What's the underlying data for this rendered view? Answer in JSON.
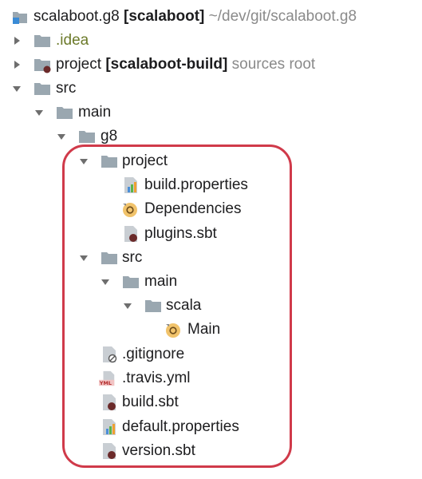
{
  "tree": {
    "root": {
      "name": "scalaboot.g8",
      "module": "[scalaboot]",
      "path": "~/dev/git/scalaboot.g8",
      "icon": "module-folder-icon"
    },
    "idea": {
      "label": ".idea",
      "icon": "folder-icon"
    },
    "project_root": {
      "label": "project",
      "module": "[scalaboot-build]",
      "hint": "sources root",
      "icon": "sbt-folder-icon"
    },
    "src": {
      "label": "src",
      "icon": "folder-icon"
    },
    "main": {
      "label": "main",
      "icon": "folder-icon"
    },
    "g8": {
      "label": "g8",
      "icon": "folder-icon"
    },
    "g8_project": {
      "label": "project",
      "icon": "folder-icon"
    },
    "build_properties": {
      "label": "build.properties",
      "icon": "properties-file-icon"
    },
    "dependencies": {
      "label": "Dependencies",
      "icon": "scala-object-icon"
    },
    "plugins_sbt": {
      "label": "plugins.sbt",
      "icon": "sbt-file-icon"
    },
    "g8_src": {
      "label": "src",
      "icon": "folder-icon"
    },
    "g8_main": {
      "label": "main",
      "icon": "folder-icon"
    },
    "g8_scala": {
      "label": "scala",
      "icon": "folder-icon"
    },
    "main_obj": {
      "label": "Main",
      "icon": "scala-object-icon"
    },
    "gitignore": {
      "label": ".gitignore",
      "icon": "ignored-file-icon"
    },
    "travis": {
      "label": ".travis.yml",
      "icon": "yml-file-icon"
    },
    "build_sbt": {
      "label": "build.sbt",
      "icon": "sbt-file-icon"
    },
    "default_properties": {
      "label": "default.properties",
      "icon": "properties-file-icon"
    },
    "version_sbt": {
      "label": "version.sbt",
      "icon": "sbt-file-icon"
    }
  },
  "colors": {
    "folder": "#9aa7b0",
    "highlight": "#d03a4a",
    "scala_object": "#f1c36b",
    "sbt_dot": "#6b2a2a",
    "module_blue": "#3a8bd6"
  }
}
